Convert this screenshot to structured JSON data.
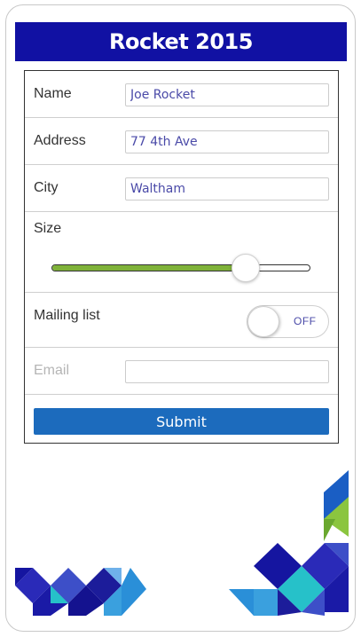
{
  "app": {
    "title": "Rocket 2015"
  },
  "form": {
    "name": {
      "label": "Name",
      "value": "Joe Rocket"
    },
    "address": {
      "label": "Address",
      "value": "77 4th Ave"
    },
    "city": {
      "label": "City",
      "value": "Waltham"
    },
    "size": {
      "label": "Size",
      "value_fraction": 0.75
    },
    "mailing_list": {
      "label": "Mailing list",
      "state": "OFF"
    },
    "email": {
      "label": "Email",
      "value": ""
    },
    "submit_label": "Submit"
  },
  "colors": {
    "title_bg": "#1111a3",
    "slider_fill": "#7fb239",
    "submit_bg": "#1c6bbd",
    "input_text": "#4a4aa8"
  }
}
